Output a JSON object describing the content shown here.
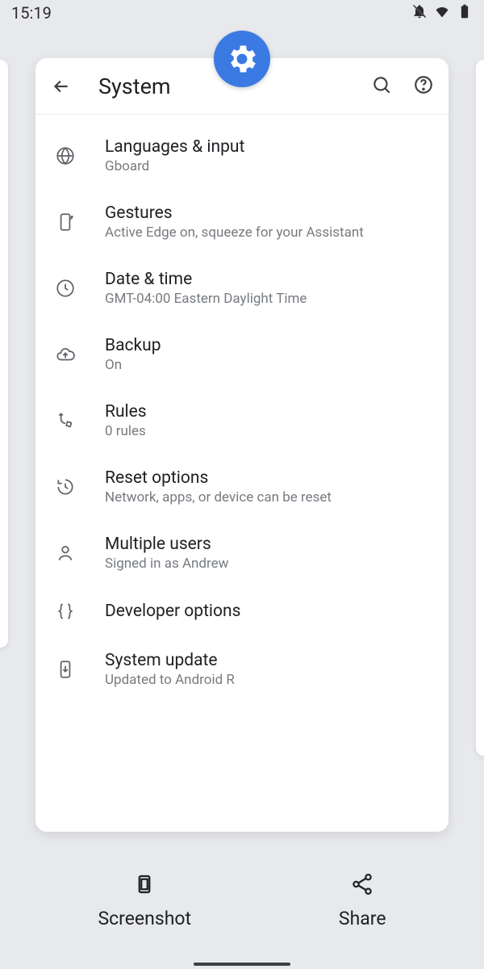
{
  "statusBar": {
    "time": "15:19"
  },
  "header": {
    "title": "System"
  },
  "items": [
    {
      "name": "languages-input",
      "icon": "globe-icon",
      "label": "Languages & input",
      "sub": "Gboard"
    },
    {
      "name": "gestures",
      "icon": "phone-icon",
      "label": "Gestures",
      "sub": "Active Edge on, squeeze for your Assistant"
    },
    {
      "name": "date-time",
      "icon": "clock-icon",
      "label": "Date & time",
      "sub": "GMT-04:00 Eastern Daylight Time"
    },
    {
      "name": "backup",
      "icon": "cloud-up-icon",
      "label": "Backup",
      "sub": "On"
    },
    {
      "name": "rules",
      "icon": "rules-icon",
      "label": "Rules",
      "sub": "0 rules"
    },
    {
      "name": "reset-options",
      "icon": "history-icon",
      "label": "Reset options",
      "sub": "Network, apps, or device can be reset"
    },
    {
      "name": "multiple-users",
      "icon": "person-icon",
      "label": "Multiple users",
      "sub": "Signed in as Andrew"
    },
    {
      "name": "developer-options",
      "icon": "braces-icon",
      "label": "Developer options",
      "sub": ""
    },
    {
      "name": "system-update",
      "icon": "phone-down-icon",
      "label": "System update",
      "sub": "Updated to Android R"
    }
  ],
  "bottom": {
    "screenshot": "Screenshot",
    "share": "Share"
  }
}
